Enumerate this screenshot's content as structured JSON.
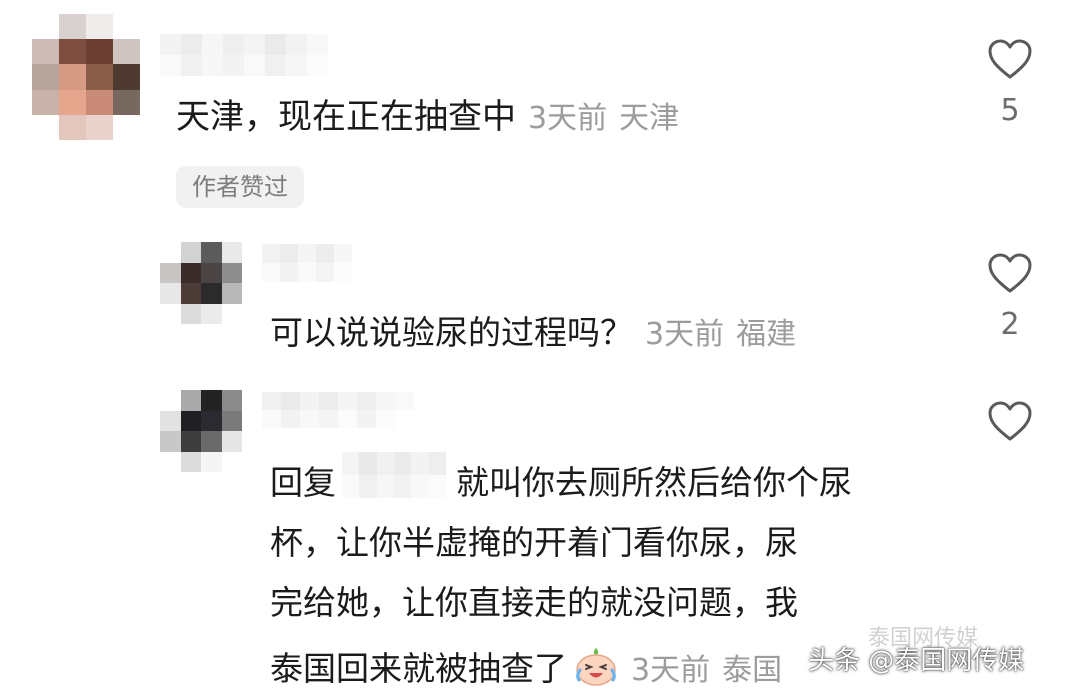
{
  "comment": {
    "text": "天津，现在正在抽查中",
    "time": "3天前",
    "location": "天津",
    "likes": "5",
    "author_liked_badge": "作者赞过"
  },
  "replies": [
    {
      "text": "可以说说验尿的过程吗？",
      "time": "3天前",
      "location": "福建",
      "likes": "2"
    },
    {
      "text_prefix": "回复",
      "text_line1": "就叫你去厕所然后给你个尿",
      "text_line2": "杯，让你半虚掩的开着门看你尿，尿",
      "text_line3": "完给她，让你直接走的就没问题，我",
      "text_line4": "泰国回来就被抽查了",
      "time": "3天前",
      "location_partial": "泰国",
      "likes": ""
    }
  ],
  "watermark": {
    "faint": "泰国网传媒",
    "main": "头条 @泰国网传媒"
  },
  "icons": {
    "like": "heart-outline-icon",
    "emoji": "crying-laughing-emoji-icon"
  },
  "colors": {
    "text": "#1b1b1b",
    "meta": "#9c9c9c",
    "badge_bg": "#f1f1f1"
  }
}
